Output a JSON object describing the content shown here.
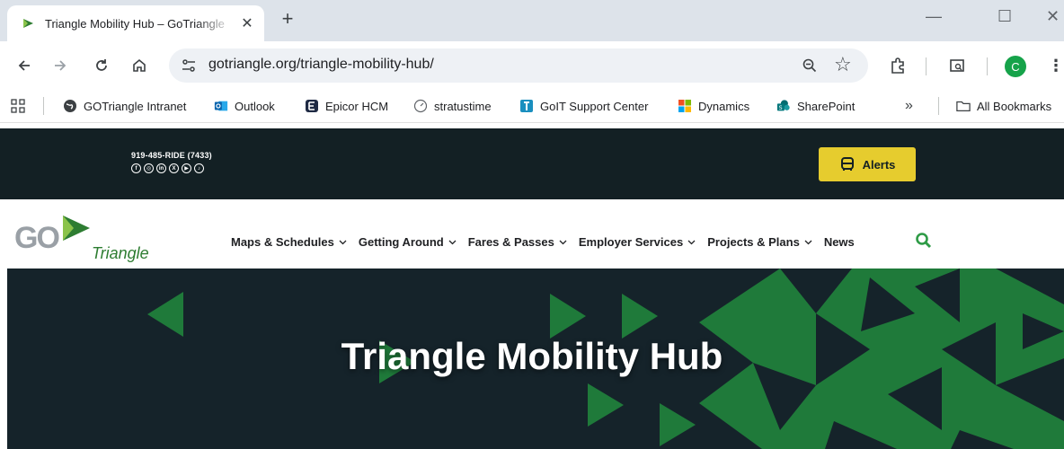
{
  "browser": {
    "tab": {
      "title": "Triangle Mobility Hub – GoTriangle",
      "close": "✕"
    },
    "new_tab": "+",
    "window_controls": {
      "minimize": "—",
      "maximize": "☐",
      "close": "✕"
    },
    "url": "gotriangle.org/triangle-mobility-hub/",
    "profile_initial": "C",
    "bookmarks": [
      {
        "label": "GOTriangle Intranet",
        "icon": "globe-icon"
      },
      {
        "label": "Outlook",
        "icon": "outlook-icon"
      },
      {
        "label": "Epicor HCM",
        "icon": "epicor-icon"
      },
      {
        "label": "stratustime",
        "icon": "clock-icon"
      },
      {
        "label": "GoIT Support Center",
        "icon": "support-icon"
      },
      {
        "label": "Dynamics",
        "icon": "microsoft-icon"
      },
      {
        "label": "SharePoint",
        "icon": "sharepoint-icon"
      }
    ],
    "bookmarks_overflow": "»",
    "all_bookmarks": "All Bookmarks"
  },
  "site": {
    "phone": "919-485-RIDE (7433)",
    "socials": [
      "facebook-icon",
      "instagram-icon",
      "linkedin-icon",
      "x-icon",
      "youtube-icon",
      "tiktok-icon"
    ],
    "alerts_label": "Alerts",
    "logo": {
      "go": "GO",
      "triangle": "Triangle"
    },
    "nav": [
      {
        "label": "Maps & Schedules",
        "dropdown": true
      },
      {
        "label": "Getting Around",
        "dropdown": true
      },
      {
        "label": "Fares & Passes",
        "dropdown": true
      },
      {
        "label": "Employer Services",
        "dropdown": true
      },
      {
        "label": "Projects & Plans",
        "dropdown": true
      },
      {
        "label": "News",
        "dropdown": false
      }
    ],
    "hero_title": "Triangle Mobility Hub"
  },
  "colors": {
    "topbar": "#132024",
    "alerts": "#e6cc2e",
    "brand_green": "#2e7d32",
    "hero_bg": "#15232a",
    "hero_triangle": "#1f7a3a"
  }
}
